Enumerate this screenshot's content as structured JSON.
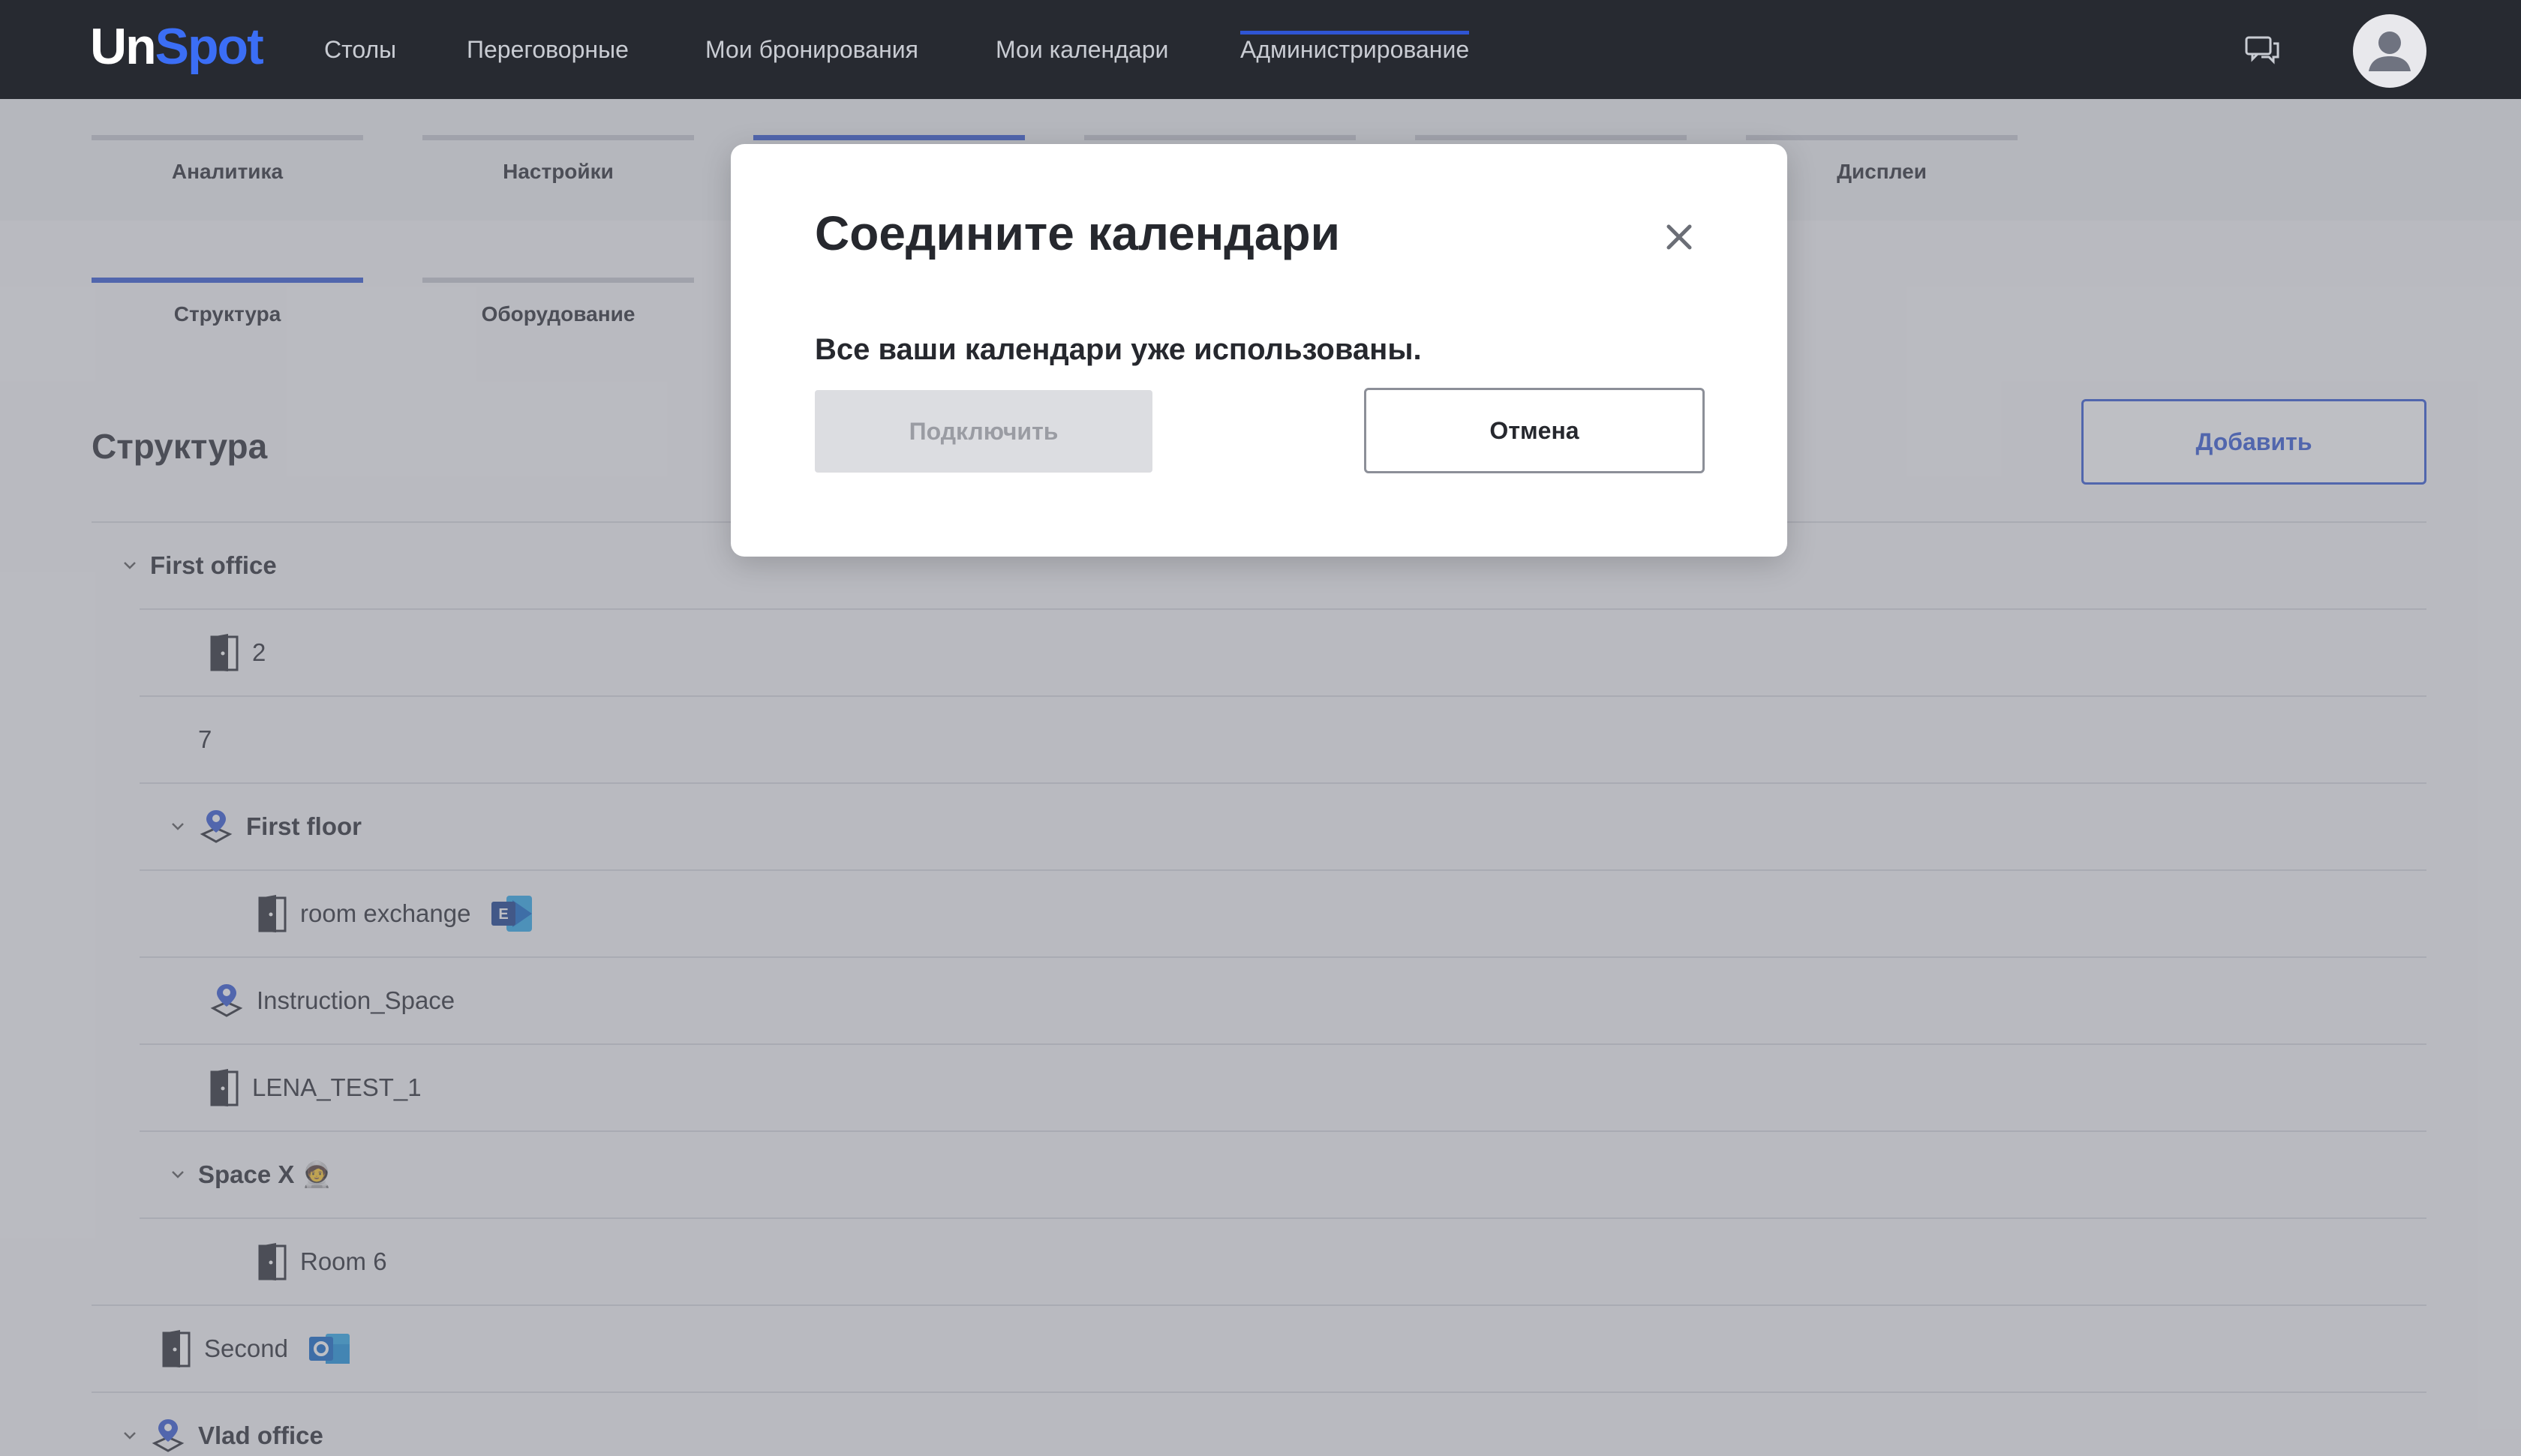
{
  "brand": {
    "part1": "Un",
    "part2": "Spot"
  },
  "nav": {
    "items": [
      {
        "label": "Столы"
      },
      {
        "label": "Переговорные"
      },
      {
        "label": "Мои бронирования"
      },
      {
        "label": "Мои календари"
      },
      {
        "label": "Администрирование",
        "active": true
      }
    ]
  },
  "admin_tabs": [
    {
      "label": "Аналитика"
    },
    {
      "label": "Настройки"
    },
    {
      "label": "",
      "active": true
    },
    {
      "label": ""
    },
    {
      "label": ""
    },
    {
      "label": "Дисплеи"
    }
  ],
  "sub_tabs": [
    {
      "label": "Структура",
      "active": true
    },
    {
      "label": "Оборудование"
    }
  ],
  "structure": {
    "title": "Структура",
    "add_label": "Добавить",
    "items": [
      {
        "label": "First office",
        "bold": true,
        "expandable": true,
        "icon": "none"
      },
      {
        "label": "2",
        "icon": "door-icon"
      },
      {
        "label": "7",
        "icon": "none"
      },
      {
        "label": "First floor",
        "bold": true,
        "expandable": true,
        "icon": "floor-plan-icon"
      },
      {
        "label": "room exchange",
        "icon": "door-icon",
        "badge": "exchange-icon"
      },
      {
        "label": "Instruction_Space",
        "icon": "floor-plan-icon"
      },
      {
        "label": "LENA_TEST_1",
        "icon": "door-icon"
      },
      {
        "label": "Space X 🧑‍🚀",
        "bold": true,
        "expandable": true,
        "icon": "none"
      },
      {
        "label": "Room 6",
        "icon": "door-icon"
      },
      {
        "label": "Second",
        "icon": "door-icon",
        "badge": "outlook-icon"
      },
      {
        "label": "Vlad office",
        "bold": true,
        "expandable": true,
        "icon": "floor-plan-icon"
      }
    ]
  },
  "modal": {
    "title": "Соедините календари",
    "message": "Все ваши календари уже использованы.",
    "connect_label": "Подключить",
    "cancel_label": "Отмена"
  },
  "colors": {
    "accent": "#2f55d4",
    "topbar": "#272a31",
    "overlay": "rgba(120,122,132,0.48)"
  }
}
